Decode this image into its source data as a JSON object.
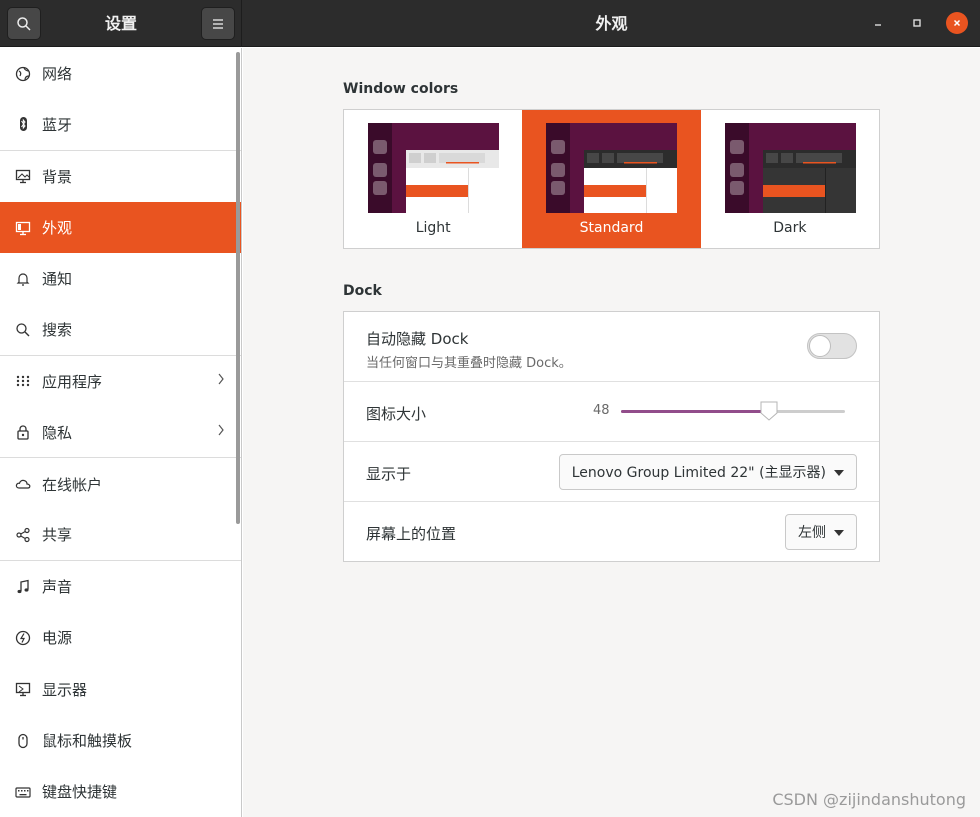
{
  "header": {
    "app_title": "设置",
    "page_title": "外观"
  },
  "sidebar": {
    "items": [
      {
        "label": "网络",
        "icon": "globe-icon"
      },
      {
        "label": "蓝牙",
        "icon": "bluetooth-icon"
      },
      {
        "label": "背景",
        "icon": "monitor-icon"
      },
      {
        "label": "外观",
        "icon": "appearance-icon",
        "active": true
      },
      {
        "label": "通知",
        "icon": "bell-icon"
      },
      {
        "label": "搜索",
        "icon": "search-icon"
      },
      {
        "label": "应用程序",
        "icon": "apps-grid-icon",
        "submenu": true
      },
      {
        "label": "隐私",
        "icon": "lock-icon",
        "submenu": true
      },
      {
        "label": "在线帐户",
        "icon": "cloud-icon"
      },
      {
        "label": "共享",
        "icon": "share-icon"
      },
      {
        "label": "声音",
        "icon": "music-note-icon"
      },
      {
        "label": "电源",
        "icon": "power-icon"
      },
      {
        "label": "显示器",
        "icon": "display-icon"
      },
      {
        "label": "鼠标和触摸板",
        "icon": "mouse-icon"
      },
      {
        "label": "键盘快捷键",
        "icon": "keyboard-icon"
      }
    ]
  },
  "window_colors": {
    "title": "Window colors",
    "options": [
      {
        "label": "Light"
      },
      {
        "label": "Standard",
        "selected": true
      },
      {
        "label": "Dark"
      }
    ]
  },
  "dock": {
    "title": "Dock",
    "autohide": {
      "label": "自动隐藏 Dock",
      "sublabel": "当任何窗口与其重叠时隐藏 Dock。",
      "enabled": false
    },
    "icon_size": {
      "label": "图标大小",
      "value": "48",
      "fraction": 0.66
    },
    "show_on": {
      "label": "显示于",
      "value": "Lenovo Group Limited 22\" (主显示器)"
    },
    "position": {
      "label": "屏幕上的位置",
      "value": "左侧"
    }
  },
  "colors": {
    "accent": "#e95420",
    "slider": "#924d8b",
    "header": "#2c2c2c"
  },
  "watermark": "CSDN @zijindanshutong"
}
